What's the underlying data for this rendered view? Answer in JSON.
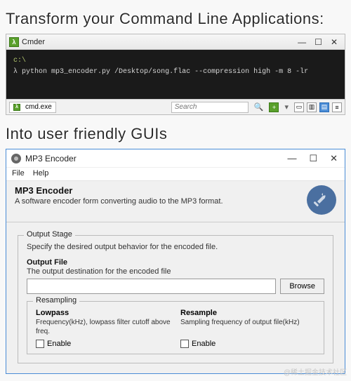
{
  "headline1": "Transform your Command Line Applications:",
  "headline2": "Into user friendly GUIs",
  "cmder": {
    "title": "Cmder",
    "prompt_path": "c:\\",
    "prompt_symbol": "λ",
    "command": "python mp3_encoder.py /Desktop/song.flac --compression high -m 8 -lr",
    "tab_label": "cmd.exe",
    "search_placeholder": "Search",
    "winctl": {
      "min": "—",
      "max": "☐",
      "close": "✕"
    }
  },
  "gui": {
    "title": "MP3 Encoder",
    "menu": {
      "file": "File",
      "help": "Help"
    },
    "header": {
      "h1": "MP3 Encoder",
      "sub": "A software encoder form converting audio to the MP3 format."
    },
    "output_stage": {
      "legend": "Output Stage",
      "desc": "Specify the desired output behavior for the encoded file.",
      "file_label": "Output File",
      "file_desc": "The output destination for the encoded file",
      "browse": "Browse",
      "resampling": {
        "legend": "Resampling",
        "lowpass": {
          "title": "Lowpass",
          "desc": "Frequency(kHz), lowpass filter cutoff above freq.",
          "enable": "Enable"
        },
        "resample": {
          "title": "Resample",
          "desc": "Sampling frequency of output file(kHz)",
          "enable": "Enable"
        }
      }
    },
    "winctl": {
      "min": "—",
      "max": "☐",
      "close": "✕"
    }
  },
  "watermark": "@稀土掘金技术社区"
}
